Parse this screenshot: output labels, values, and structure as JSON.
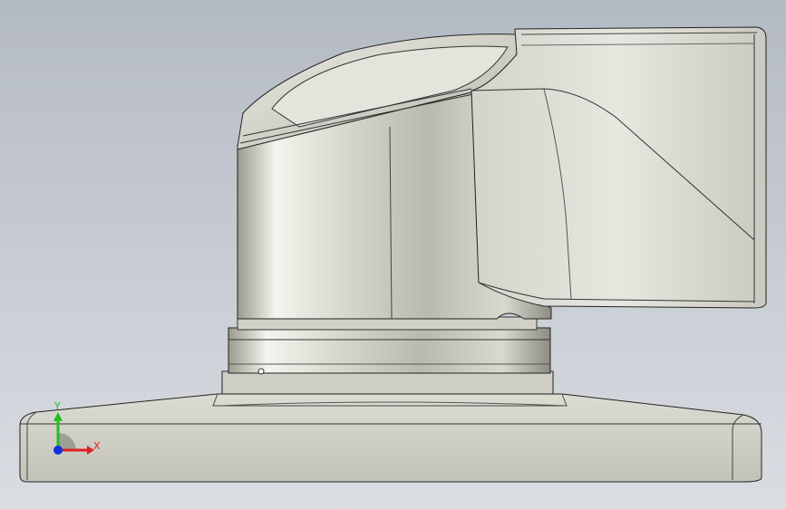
{
  "viewport": {
    "background_top": "#b6bcc6",
    "background_bottom": "#d9dde3",
    "model_fill": "#d8d8cf",
    "model_edge": "#1f1f1f"
  },
  "triad": {
    "x_label": "X",
    "y_label": "Y",
    "x_color": "#e02020",
    "y_color": "#20c020",
    "z_color": "#1030e0"
  }
}
